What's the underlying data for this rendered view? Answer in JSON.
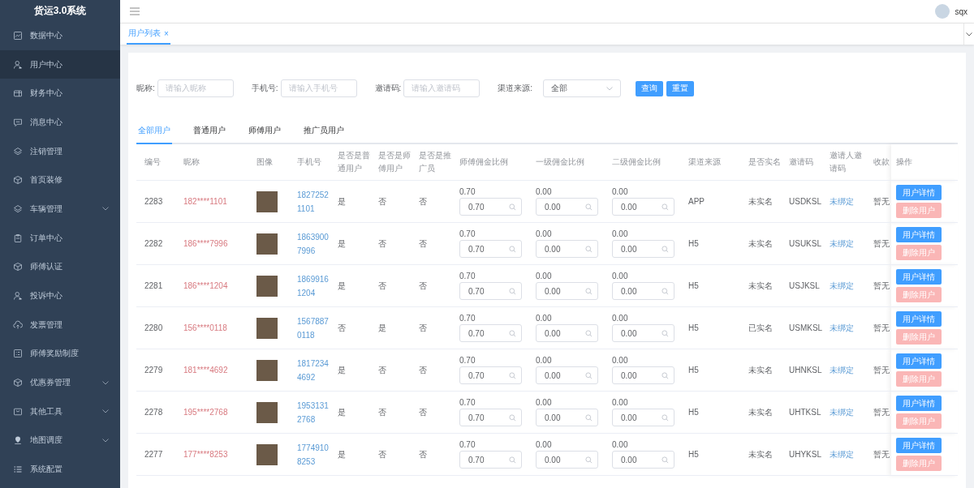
{
  "sidebar": {
    "title": "货运3.0系统",
    "items": [
      {
        "label": "数据中心",
        "selected": false,
        "expandable": false
      },
      {
        "label": "用户中心",
        "selected": true,
        "expandable": false
      },
      {
        "label": "财务中心",
        "selected": false,
        "expandable": false
      },
      {
        "label": "消息中心",
        "selected": false,
        "expandable": false
      },
      {
        "label": "注销管理",
        "selected": false,
        "expandable": false
      },
      {
        "label": "首页装修",
        "selected": false,
        "expandable": false
      },
      {
        "label": "车辆管理",
        "selected": false,
        "expandable": true
      },
      {
        "label": "订单中心",
        "selected": false,
        "expandable": false
      },
      {
        "label": "师傅认证",
        "selected": false,
        "expandable": false
      },
      {
        "label": "投诉中心",
        "selected": false,
        "expandable": false
      },
      {
        "label": "发票管理",
        "selected": false,
        "expandable": false
      },
      {
        "label": "师傅奖励制度",
        "selected": false,
        "expandable": false
      },
      {
        "label": "优惠券管理",
        "selected": false,
        "expandable": true
      },
      {
        "label": "其他工具",
        "selected": false,
        "expandable": true
      },
      {
        "label": "地图调度",
        "selected": false,
        "expandable": true
      },
      {
        "label": "系统配置",
        "selected": false,
        "expandable": false
      }
    ]
  },
  "header": {
    "username": "sqx"
  },
  "page_tabs": [
    {
      "label": "用户列表",
      "close": "×",
      "selected": true
    }
  ],
  "filters": {
    "fields": [
      {
        "label": "昵称:",
        "placeholder": "请输入昵称"
      },
      {
        "label": "手机号:",
        "placeholder": "请输入手机号"
      },
      {
        "label": "邀请码:",
        "placeholder": "请输入邀请码"
      }
    ],
    "select": {
      "label": "渠道来源:",
      "value": "全部"
    },
    "buttons": [
      "查询",
      "重置"
    ]
  },
  "user_tabs": [
    {
      "label": "全部用户",
      "selected": true
    },
    {
      "label": "普通用户",
      "selected": false
    },
    {
      "label": "师傅用户",
      "selected": false
    },
    {
      "label": "推广员用户",
      "selected": false
    }
  ],
  "table": {
    "columns": [
      "编号",
      "昵称",
      "图像",
      "手机号",
      "是否是普通用户",
      "是否是师傅用户",
      "是否是推广员",
      "师傅佣金比例",
      "一级佣金比例",
      "二级佣金比例",
      "渠道来源",
      "是否实名",
      "邀请码",
      "邀请人邀请码",
      "收款",
      "操作"
    ],
    "rows": [
      {
        "id": "2283",
        "nickname": "182****1101",
        "phone": "18272521101",
        "normal": "是",
        "master": "否",
        "promoter": "否",
        "master_ratio": "0.70",
        "master_input": "0.70",
        "l1_ratio": "0.00",
        "l1_input": "0.00",
        "l2_ratio": "0.00",
        "l2_input": "0.00",
        "channel": "APP",
        "realname": "未实名",
        "invite_code": "USDKSL",
        "inviter": "未绑定",
        "payment": "暂无",
        "actions": [
          "用户详情",
          "删除用户"
        ]
      },
      {
        "id": "2282",
        "nickname": "186****7996",
        "phone": "18639007996",
        "normal": "是",
        "master": "否",
        "promoter": "否",
        "master_ratio": "0.70",
        "master_input": "0.70",
        "l1_ratio": "0.00",
        "l1_input": "0.00",
        "l2_ratio": "0.00",
        "l2_input": "0.00",
        "channel": "H5",
        "realname": "未实名",
        "invite_code": "USUKSL",
        "inviter": "未绑定",
        "payment": "暂无",
        "actions": [
          "用户详情",
          "删除用户"
        ]
      },
      {
        "id": "2281",
        "nickname": "186****1204",
        "phone": "18699161204",
        "normal": "是",
        "master": "否",
        "promoter": "否",
        "master_ratio": "0.70",
        "master_input": "0.70",
        "l1_ratio": "0.00",
        "l1_input": "0.00",
        "l2_ratio": "0.00",
        "l2_input": "0.00",
        "channel": "H5",
        "realname": "未实名",
        "invite_code": "USJKSL",
        "inviter": "未绑定",
        "payment": "暂无",
        "actions": [
          "用户详情",
          "删除用户"
        ]
      },
      {
        "id": "2280",
        "nickname": "156****0118",
        "phone": "15678870118",
        "normal": "否",
        "master": "是",
        "promoter": "否",
        "master_ratio": "0.70",
        "master_input": "0.70",
        "l1_ratio": "0.00",
        "l1_input": "0.00",
        "l2_ratio": "0.00",
        "l2_input": "0.00",
        "channel": "H5",
        "realname": "已实名",
        "invite_code": "USMKSL",
        "inviter": "未绑定",
        "payment": "暂无",
        "actions": [
          "用户详情",
          "删除用户"
        ]
      },
      {
        "id": "2279",
        "nickname": "181****4692",
        "phone": "18172344692",
        "normal": "是",
        "master": "否",
        "promoter": "否",
        "master_ratio": "0.70",
        "master_input": "0.70",
        "l1_ratio": "0.00",
        "l1_input": "0.00",
        "l2_ratio": "0.00",
        "l2_input": "0.00",
        "channel": "H5",
        "realname": "未实名",
        "invite_code": "UHNKSL",
        "inviter": "未绑定",
        "payment": "暂无",
        "actions": [
          "用户详情",
          "删除用户"
        ]
      },
      {
        "id": "2278",
        "nickname": "195****2768",
        "phone": "19531312768",
        "normal": "是",
        "master": "否",
        "promoter": "否",
        "master_ratio": "0.70",
        "master_input": "0.70",
        "l1_ratio": "0.00",
        "l1_input": "0.00",
        "l2_ratio": "0.00",
        "l2_input": "0.00",
        "channel": "H5",
        "realname": "未实名",
        "invite_code": "UHTKSL",
        "inviter": "未绑定",
        "payment": "暂无",
        "actions": [
          "用户详情",
          "删除用户"
        ]
      },
      {
        "id": "2277",
        "nickname": "177****8253",
        "phone": "17749108253",
        "normal": "是",
        "master": "否",
        "promoter": "否",
        "master_ratio": "0.70",
        "master_input": "0.70",
        "l1_ratio": "0.00",
        "l1_input": "0.00",
        "l2_ratio": "0.00",
        "l2_input": "0.00",
        "channel": "H5",
        "realname": "未实名",
        "invite_code": "UHYKSL",
        "inviter": "未绑定",
        "payment": "暂无",
        "actions": [
          "用户详情",
          "删除用户"
        ]
      }
    ]
  }
}
